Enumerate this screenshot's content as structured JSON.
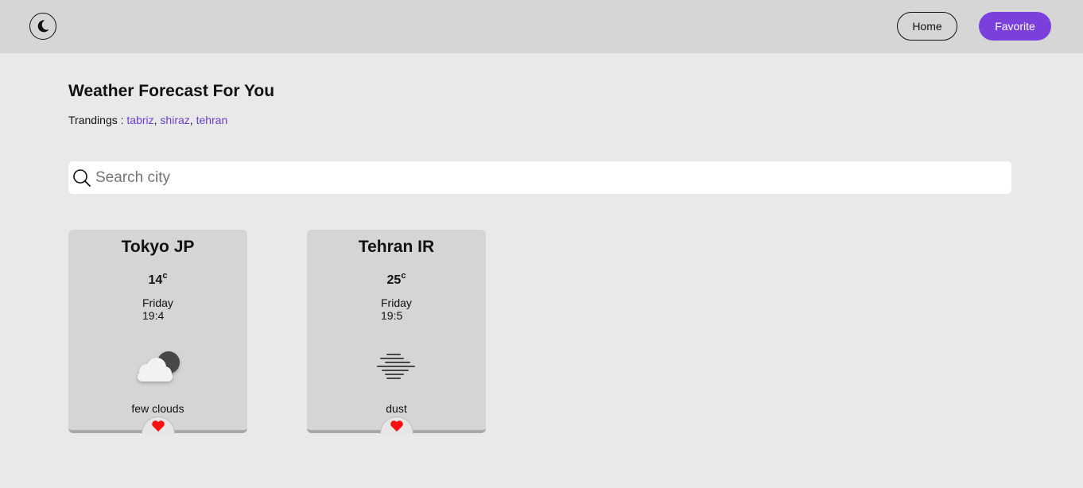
{
  "nav": {
    "home_label": "Home",
    "favorite_label": "Favorite",
    "accent_color": "#7b3fdc"
  },
  "header": {
    "title": "Weather Forecast For You",
    "trending_label": "Trandings :",
    "trending_cities": [
      "tabriz",
      "shiraz",
      "tehran"
    ]
  },
  "search": {
    "placeholder": "Search city",
    "value": ""
  },
  "cards": [
    {
      "city": "Tokyo JP",
      "temp": "14",
      "unit": "c",
      "day": "Friday",
      "time": "19:4",
      "description": "few clouds",
      "icon": "few-clouds-night-icon"
    },
    {
      "city": "Tehran IR",
      "temp": "25",
      "unit": "c",
      "day": "Friday",
      "time": "19:5",
      "description": "dust",
      "icon": "dust-icon"
    }
  ]
}
